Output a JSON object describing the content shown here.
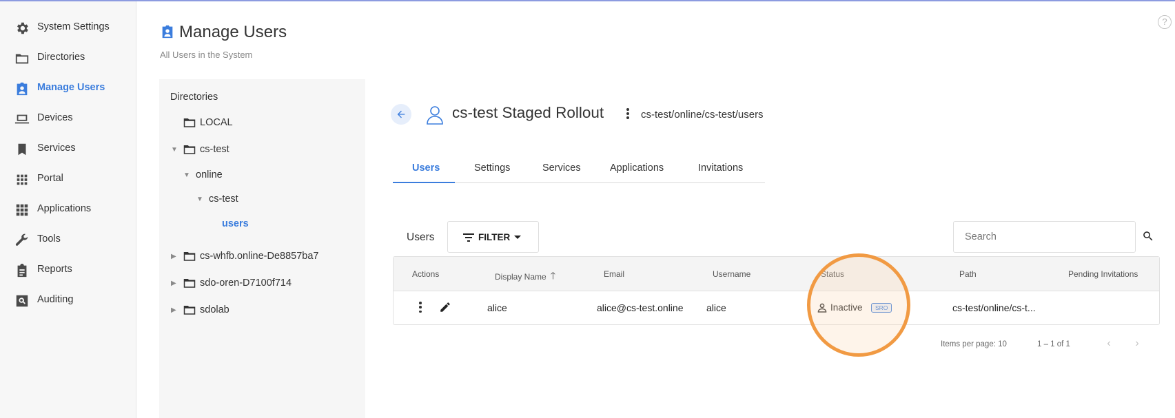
{
  "colors": {
    "accent": "#3b7ddd",
    "highlight": "#f19a43"
  },
  "help": {
    "glyph": "?"
  },
  "sidebar": {
    "items": [
      {
        "label": "System Settings",
        "icon": "gear-icon"
      },
      {
        "label": "Directories",
        "icon": "folder-icon"
      },
      {
        "label": "Manage Users",
        "icon": "user-badge-icon",
        "active": true
      },
      {
        "label": "Devices",
        "icon": "laptop-icon"
      },
      {
        "label": "Services",
        "icon": "bookmark-icon"
      },
      {
        "label": "Portal",
        "icon": "grid-dots-icon"
      },
      {
        "label": "Applications",
        "icon": "apps-grid-icon"
      },
      {
        "label": "Tools",
        "icon": "wrench-icon"
      },
      {
        "label": "Reports",
        "icon": "clipboard-icon"
      },
      {
        "label": "Auditing",
        "icon": "search-box-icon"
      }
    ]
  },
  "header": {
    "title": "Manage Users",
    "subtitle": "All Users in the System"
  },
  "tree": {
    "heading": "Directories",
    "items": [
      {
        "label": "LOCAL",
        "arrow": ""
      },
      {
        "label": "cs-test",
        "arrow": "▼"
      },
      {
        "label": "online",
        "arrow": "▼"
      },
      {
        "label": "cs-test",
        "arrow": "▼"
      },
      {
        "label": "users",
        "arrow": ""
      },
      {
        "label": "cs-whfb.online-De8857ba7",
        "arrow": "▶"
      },
      {
        "label": "sdo-oren-D7100f714",
        "arrow": "▶"
      },
      {
        "label": "sdolab",
        "arrow": "▶"
      }
    ]
  },
  "group": {
    "title": "cs-test Staged Rollout",
    "path": "cs-test/online/cs-test/users"
  },
  "tabs": [
    {
      "label": "Users",
      "active": true
    },
    {
      "label": "Settings"
    },
    {
      "label": "Services"
    },
    {
      "label": "Applications"
    },
    {
      "label": "Invitations"
    }
  ],
  "toolbar": {
    "users_label": "Users",
    "filter_label": "FILTER",
    "search_placeholder": "Search"
  },
  "table": {
    "columns": [
      "Actions",
      "Display Name",
      "Email",
      "Username",
      "Status",
      "Path",
      "Pending Invitations"
    ],
    "sort_glyph": "🡑",
    "rows": [
      {
        "display_name": "alice",
        "email": "alice@cs-test.online",
        "username": "alice",
        "status": "Inactive",
        "status_badge": "SRO",
        "path": "cs-test/online/cs-t..."
      }
    ]
  },
  "pagination": {
    "items_per_page": "Items per page: 10",
    "range": "1 – 1 of 1",
    "prev_glyph": "‹",
    "next_glyph": "›"
  }
}
